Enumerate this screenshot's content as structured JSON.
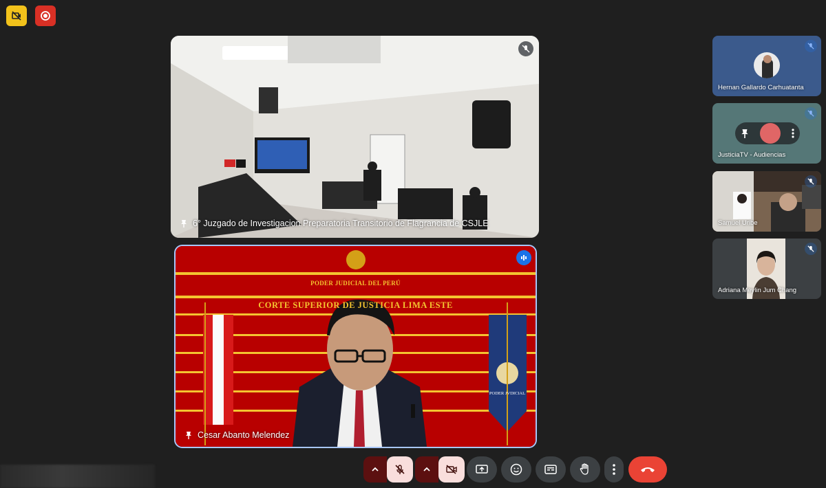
{
  "top_badges": {
    "no_video_indicator": "no-video-icon",
    "record_indicator": "record-icon"
  },
  "main_tiles": {
    "room": {
      "name": "6° Juzgado de Investigacion Preparatoria Transitorio de Flagrancia de CSJLE",
      "muted": true
    },
    "speaker": {
      "name": "Cesar Abanto Melendez",
      "background_text_1": "PODER JUDICIAL DEL PERÚ",
      "background_text_2": "CORTE SUPERIOR DE JUSTICIA LIMA ESTE",
      "flag_emblem_text": "PODER JVDICIAL",
      "speaking": true
    }
  },
  "side_tiles": [
    {
      "name": "Hernan Gallardo Carhuatanta",
      "muted": true
    },
    {
      "name": "JusticiaTV - Audiencias",
      "muted": true
    },
    {
      "name": "Samuel Uribe",
      "muted": true
    },
    {
      "name": "Adriana Meylin Jum Chang",
      "muted": true
    }
  ],
  "controls": [
    "mic-off",
    "camera-off",
    "present-screen",
    "emoji",
    "captions",
    "raise-hand",
    "more-options",
    "leave-call"
  ],
  "colors": {
    "background": "#1f1f1f",
    "danger": "#ea4335",
    "active_speaker": "#a8c7fa"
  }
}
